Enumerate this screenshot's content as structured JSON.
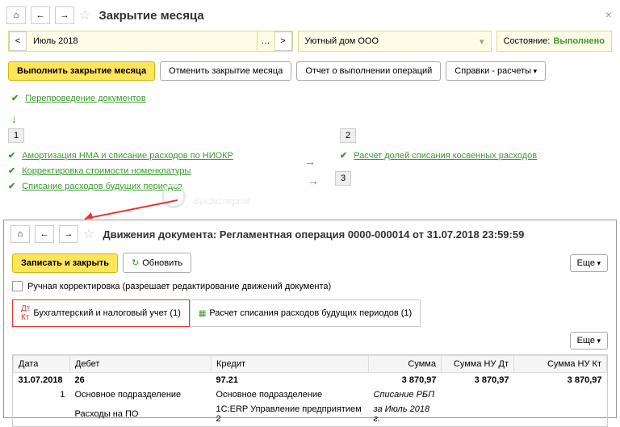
{
  "upper": {
    "title": "Закрытие месяца",
    "period": "Июль 2018",
    "org": "Уютный дом ООО",
    "stateLabel": "Состояние:",
    "stateValue": "Выполнено",
    "buttons": {
      "exec": "Выполнить закрытие месяца",
      "cancel": "Отменить закрытие месяца",
      "report": "Отчет о выполнении операций",
      "ref": "Справки - расчеты"
    },
    "repost": "Перепроведение документов",
    "col1": {
      "num": "1",
      "items": [
        "Амортизация НМА и списание расходов по НИОКР",
        "Корректировка стоимости номенклатуры",
        "Списание расходов будущих периодов"
      ]
    },
    "col2": {
      "num": "2",
      "items": [
        "Расчет долей списания косвенных расходов"
      ],
      "next": "3"
    }
  },
  "lower": {
    "title": "Движения документа: Регламентная операция 0000-000014 от 31.07.2018 23:59:59",
    "buttons": {
      "save": "Записать и закрыть",
      "refresh": "Обновить",
      "more": "Еще"
    },
    "manualEdit": "Ручная корректировка (разрешает редактирование движений документа)",
    "tabs": {
      "acct": "Бухгалтерский и налоговый учет (1)",
      "calc": "Расчет списания расходов будущих периодов (1)"
    },
    "headers": {
      "date": "Дата",
      "debit": "Дебет",
      "credit": "Кредит",
      "sum": "Сумма",
      "sumDt": "Сумма НУ Дт",
      "sumKt": "Сумма НУ Кт"
    },
    "row": {
      "date": "31.07.2018",
      "n": "1",
      "dt": "26",
      "kt": "97.21",
      "sum": "3 870,97",
      "sumDt": "3 870,97",
      "sumKt": "3 870,97",
      "dtSub1": "Основное подразделение",
      "ktSub1": "Основное подразделение",
      "note1": "Списание РБП",
      "note2": "за Июль 2018 г.",
      "dtSub2": "Расходы на ПО",
      "ktSub2": "1С:ERP Управление предприятием 2"
    }
  },
  "wm": "БухЭксперт8"
}
